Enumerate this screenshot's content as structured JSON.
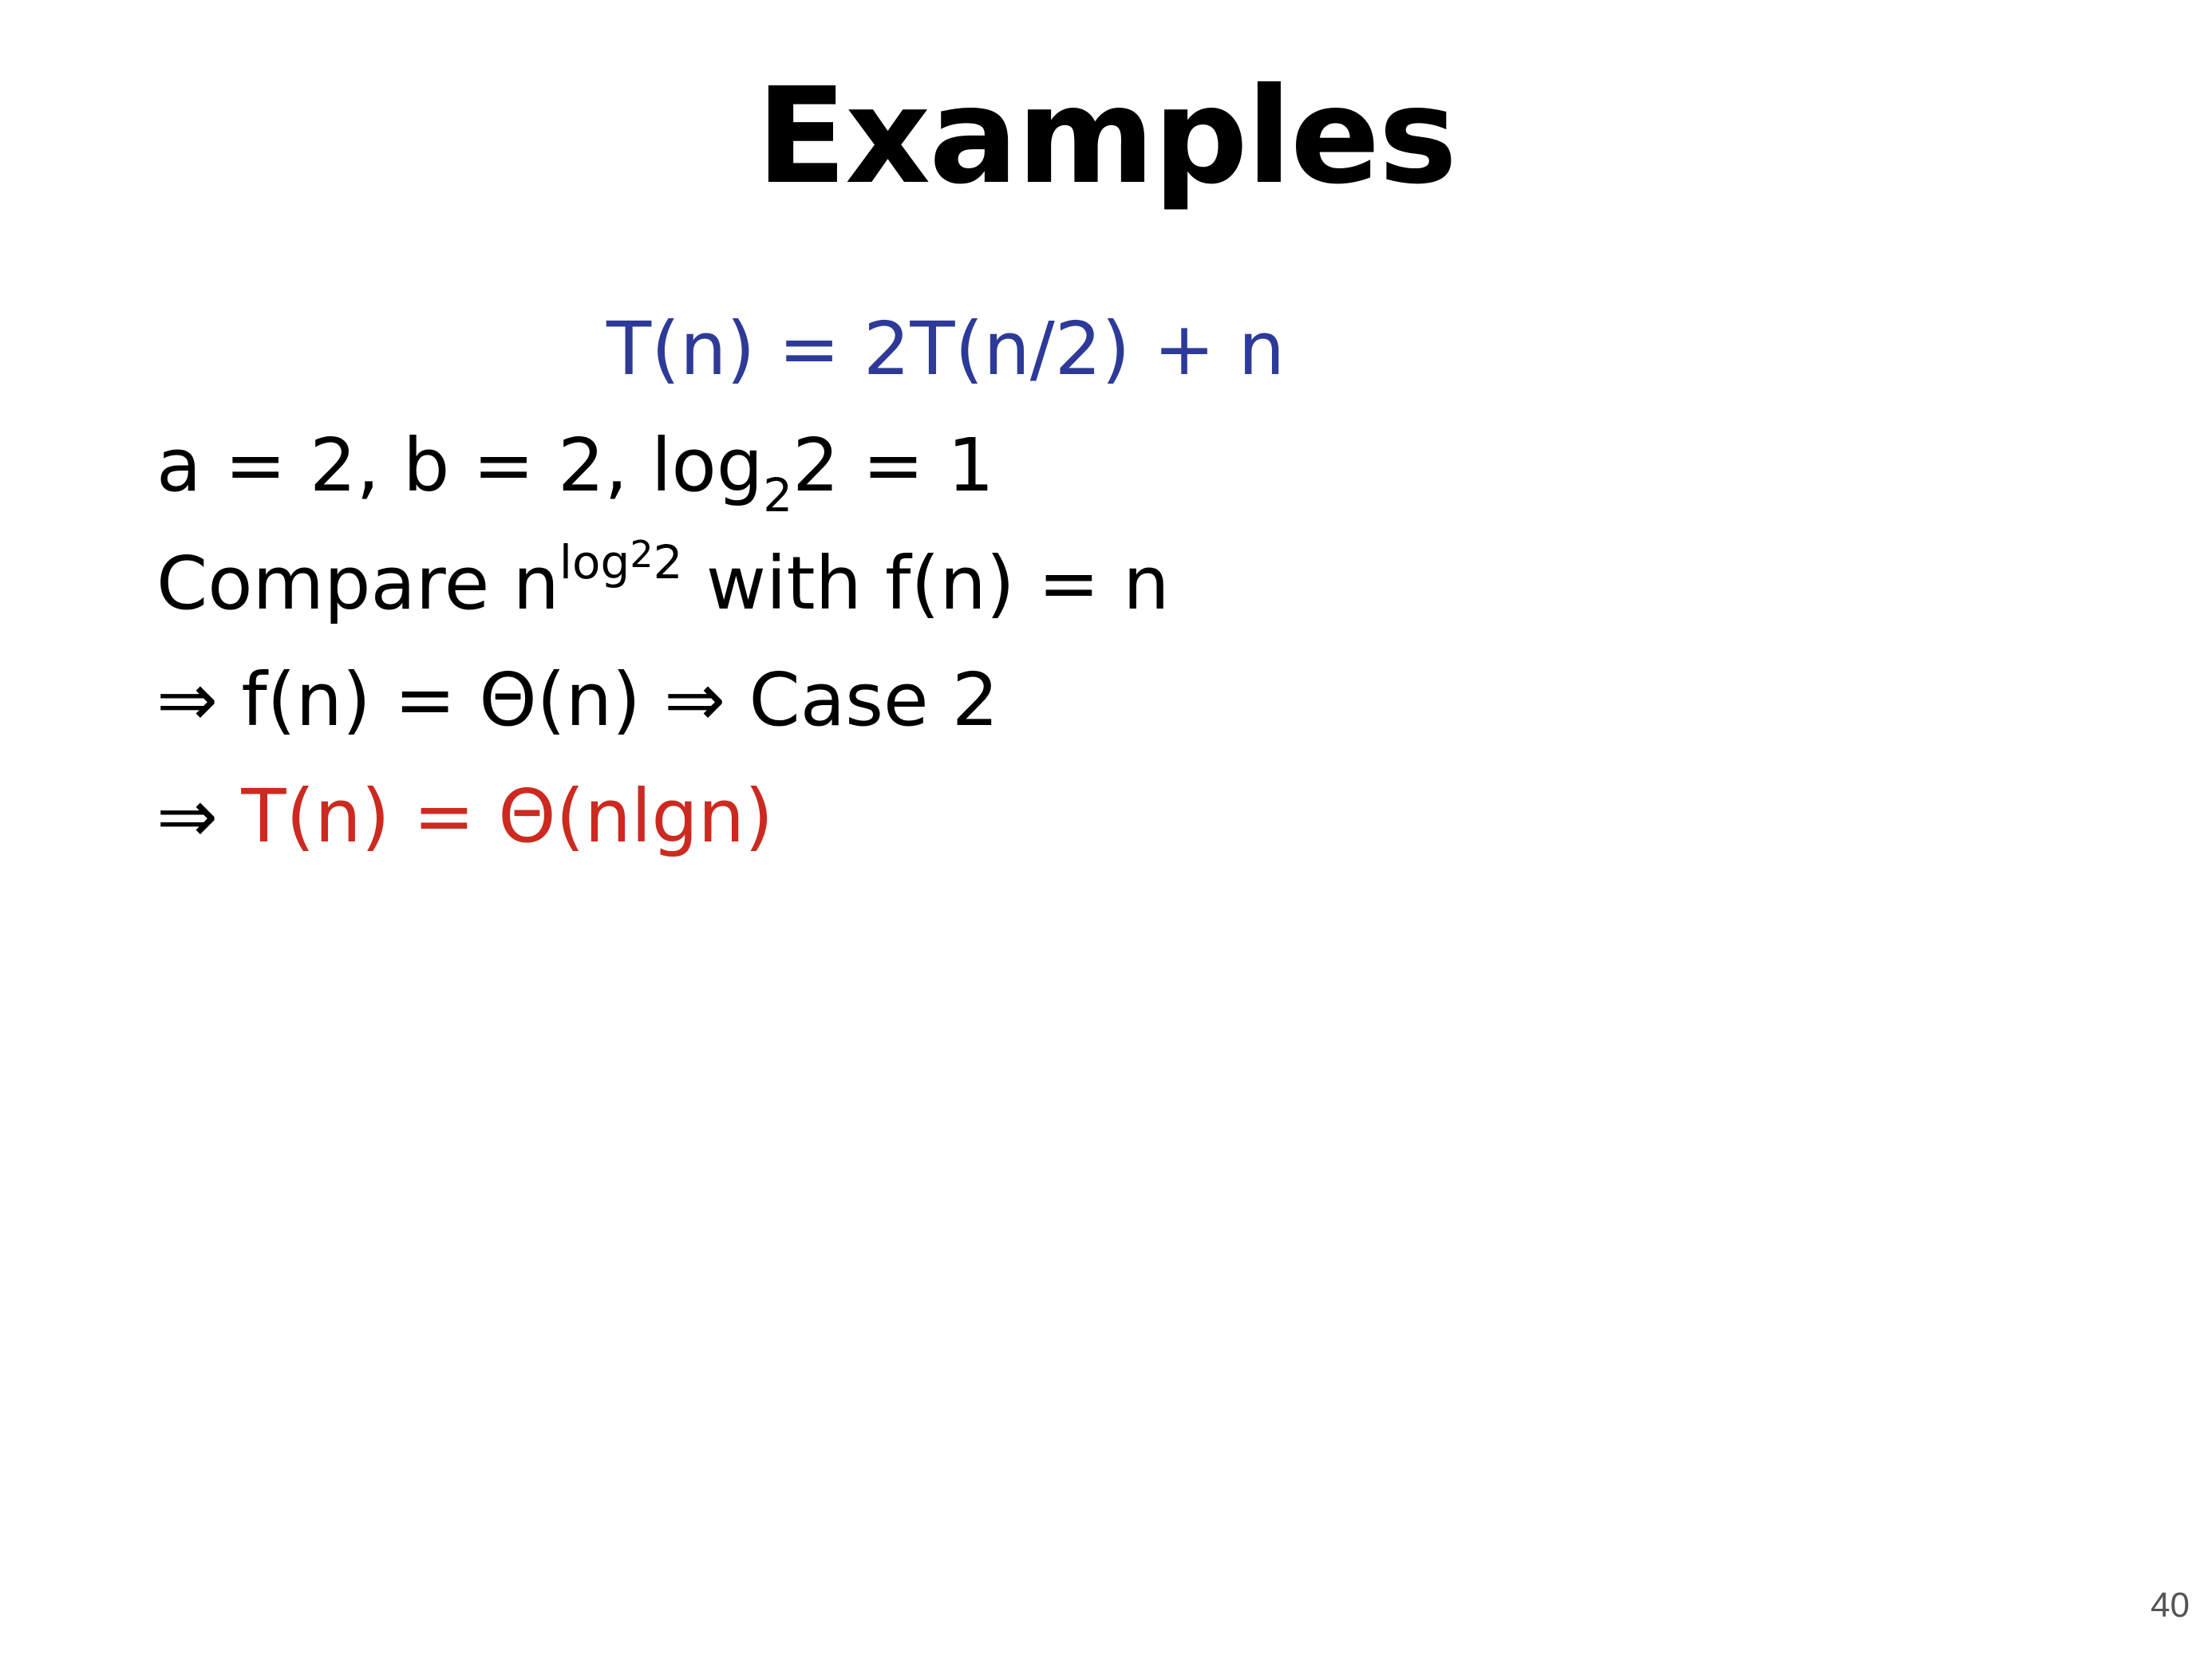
{
  "slide": {
    "title": "Examples",
    "recurrence": "T(n) = 2T(n/2) + n",
    "params": {
      "prefix": "a = 2, b = 2, log",
      "sub": "2",
      "suffix": "2 = 1"
    },
    "compare": {
      "prefix": "Compare n",
      "sup_log": "log",
      "sup_sub": "2",
      "sup_tail": "2",
      "suffix": " with f(n) = n"
    },
    "case_line": {
      "arrow": "⇒",
      "text": " f(n) = Θ(n) ⇒ Case 2"
    },
    "result_line": {
      "arrow": "⇒",
      "text": " T(n) = Θ(nlgn)"
    },
    "page_number": "40"
  },
  "colors": {
    "recurrence": "#2e3a98",
    "result": "#cc2a20",
    "text": "#000000"
  }
}
